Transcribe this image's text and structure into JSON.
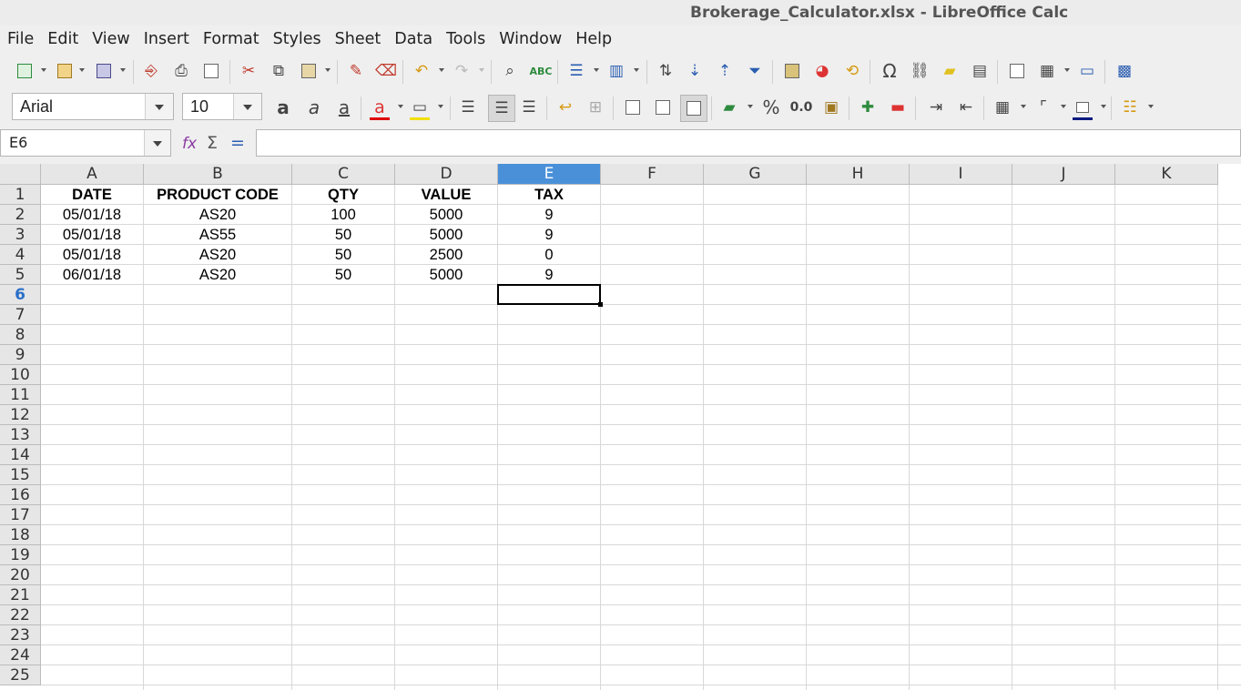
{
  "window": {
    "title": "Brokerage_Calculator.xlsx - LibreOffice Calc"
  },
  "menu": [
    "File",
    "Edit",
    "View",
    "Insert",
    "Format",
    "Styles",
    "Sheet",
    "Data",
    "Tools",
    "Window",
    "Help"
  ],
  "format_toolbar": {
    "font_name": "Arial",
    "font_size": "10",
    "percent_label": "%",
    "decimal_label": "0.0"
  },
  "formula_bar": {
    "cell_ref": "E6",
    "formula": ""
  },
  "sheet": {
    "columns": [
      "A",
      "B",
      "C",
      "D",
      "E",
      "F",
      "G",
      "H",
      "I",
      "J",
      "K"
    ],
    "rows": [
      "1",
      "2",
      "3",
      "4",
      "5",
      "6",
      "7",
      "8",
      "9",
      "10",
      "11",
      "12",
      "13",
      "14",
      "15",
      "16",
      "17",
      "18",
      "19",
      "20",
      "21",
      "22",
      "23",
      "24",
      "25"
    ],
    "selected_column": "E",
    "selected_row": "6",
    "header_row": [
      "DATE",
      "PRODUCT CODE",
      "QTY",
      "VALUE",
      "TAX"
    ],
    "data_rows": [
      [
        "05/01/18",
        "AS20",
        "100",
        "5000",
        "9"
      ],
      [
        "05/01/18",
        "AS55",
        "50",
        "5000",
        "9"
      ],
      [
        "05/01/18",
        "AS20",
        "50",
        "2500",
        "0"
      ],
      [
        "06/01/18",
        "AS20",
        "50",
        "5000",
        "9"
      ]
    ]
  },
  "colors": {
    "selection_header": "#4a90d9",
    "grid_line": "#d8d8d8"
  }
}
